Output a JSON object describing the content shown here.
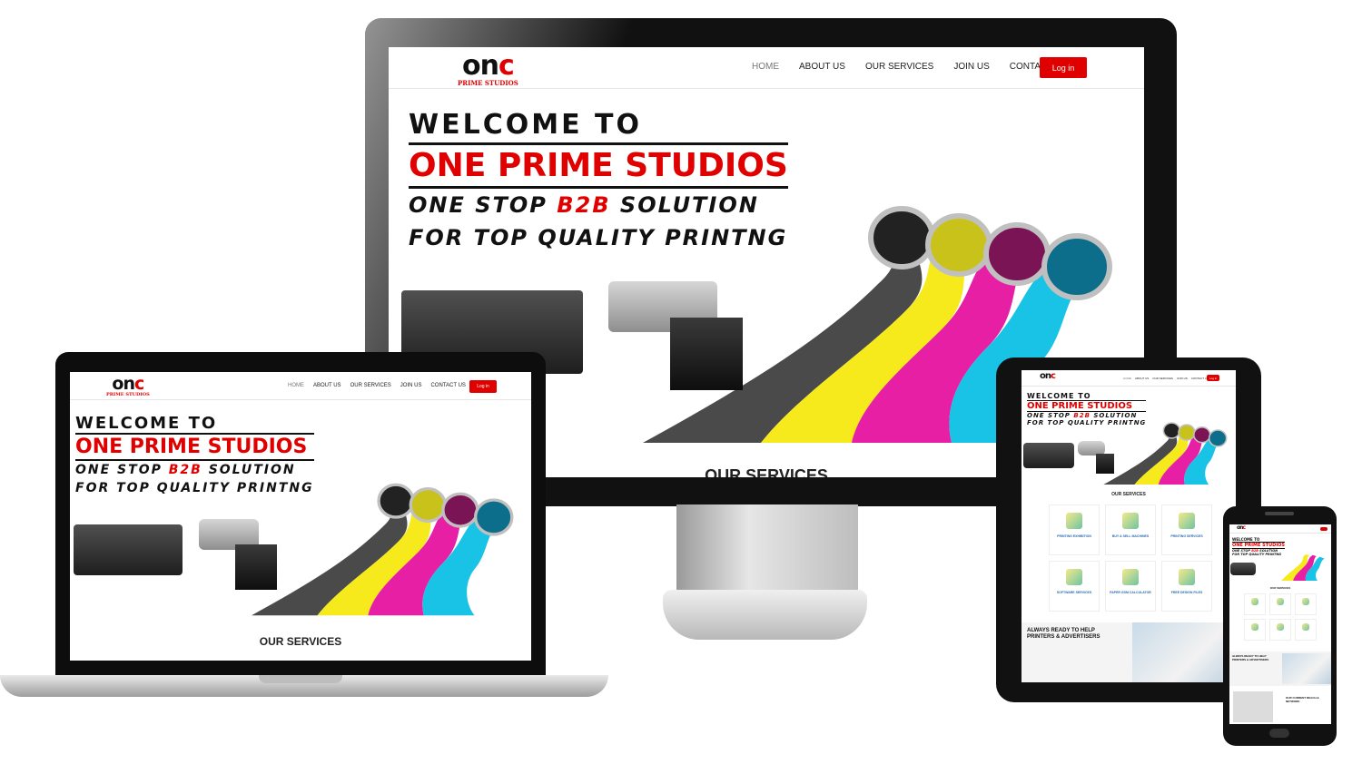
{
  "brand": {
    "logo_mark_a": "on",
    "logo_mark_c": "c",
    "logo_sub": "PRIME STUDIOS"
  },
  "nav": {
    "home": "HOME",
    "about": "ABOUT US",
    "services": "OUR SERVICES",
    "join": "JOIN US",
    "contact": "CONTACT US",
    "login": "Log in"
  },
  "hero": {
    "line1": "WELCOME TO",
    "line2": "ONE PRIME STUDIOS",
    "line3_a": "ONE STOP ",
    "line3_b": "B2B",
    "line3_c": " SOLUTION",
    "line4": "FOR TOP QUALITY PRINTNG"
  },
  "sections": {
    "services_title": "OUR SERVICES",
    "ready_title_1": "ALWAYS READY TO HELP",
    "ready_title_2": "PRINTERS & ADVERTISERS",
    "reach_title_1": "OUR CURRENT REACH &",
    "reach_title_2": "NETWORK"
  },
  "services": [
    {
      "title": "PRINTING EXHIBITION"
    },
    {
      "title": "BUY & SELL MACHINES"
    },
    {
      "title": "PRINTING SERVICES"
    },
    {
      "title": "SOFTWARE SERVICES"
    },
    {
      "title": "PAPER GSM CALCULATOR"
    },
    {
      "title": "FREE DESIGN FILES"
    }
  ],
  "colors": {
    "accent": "#e10000",
    "cyan": "#19c3e6",
    "magenta": "#e61fa5",
    "yellow": "#f6ea1c",
    "key": "#4a4a4a"
  },
  "icons": {
    "can_black": "paint-can-icon",
    "can_yellow": "paint-can-icon",
    "can_magenta": "paint-can-icon",
    "can_cyan": "paint-can-icon"
  }
}
